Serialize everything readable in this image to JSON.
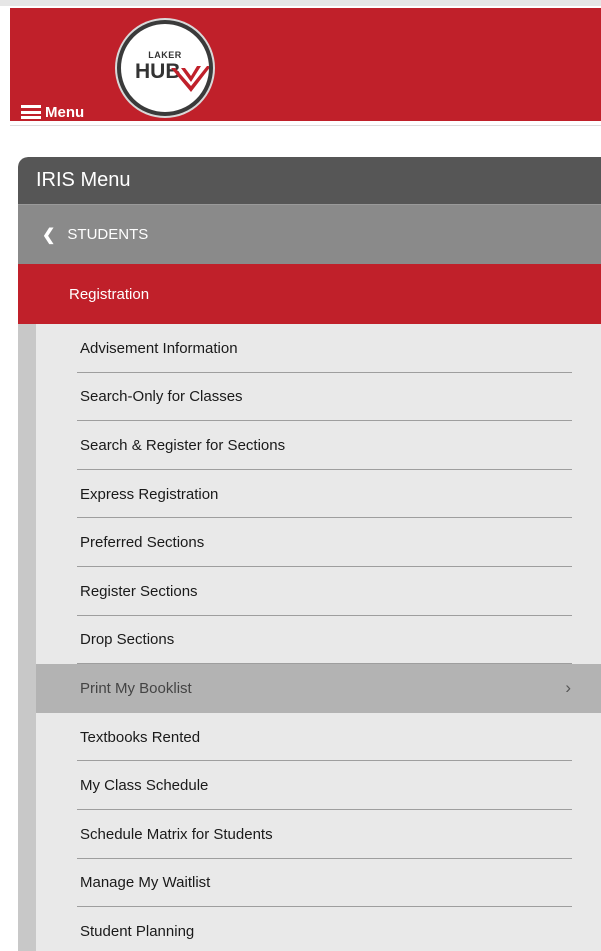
{
  "header": {
    "menu_label": "Menu",
    "logo_top": "LAKER",
    "logo_main": "HUB",
    "brand_color": "#c0202a"
  },
  "panel": {
    "title": "IRIS Menu",
    "breadcrumb": "STUDENTS",
    "section": "Registration",
    "items": [
      {
        "label": "Advisement Information"
      },
      {
        "label": "Search-Only for Classes"
      },
      {
        "label": "Search & Register for Sections"
      },
      {
        "label": "Express Registration"
      },
      {
        "label": "Preferred Sections"
      },
      {
        "label": "Register Sections"
      },
      {
        "label": "Drop Sections"
      },
      {
        "label": "Print My Booklist",
        "active": true,
        "icon": "chevron-right-icon"
      },
      {
        "label": "Textbooks Rented"
      },
      {
        "label": "My Class Schedule"
      },
      {
        "label": "Schedule Matrix for Students"
      },
      {
        "label": "Manage My Waitlist"
      },
      {
        "label": "Student Planning"
      }
    ]
  }
}
